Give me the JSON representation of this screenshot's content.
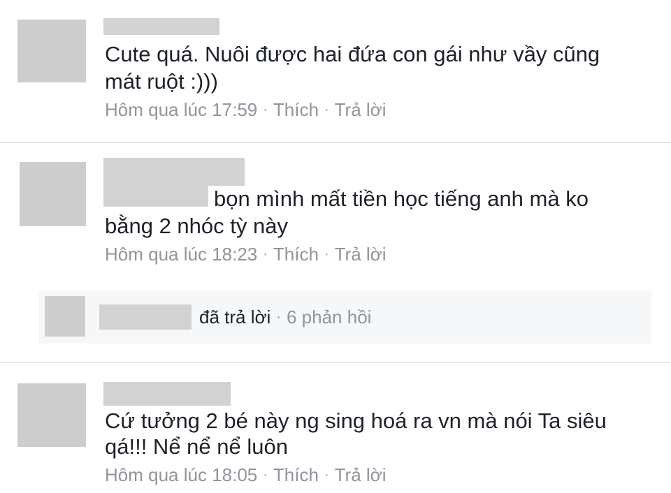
{
  "comments": [
    {
      "text_line1": "Cute quá. Nuôi được hai đứa con gái như vầy cũng",
      "text_line2": "mát ruột :)))",
      "timestamp": "Hôm qua lúc 17:59",
      "like_label": "Thích",
      "reply_label": "Trả lời"
    },
    {
      "text_line1": "bọn mình mất  tiền học tiếng anh mà ko",
      "text_line2": "bằng 2 nhóc tỳ này",
      "timestamp": "Hôm qua lúc 18:23",
      "like_label": "Thích",
      "reply_label": "Trả lời"
    },
    {
      "text_line1": "Cứ tưởng 2 bé này ng sing hoá ra vn mà nói Ta siêu",
      "text_line2": "qá!!! Nể nể nể luôn",
      "timestamp": "Hôm qua lúc 18:05",
      "like_label": "Thích",
      "reply_label": "Trả lời"
    }
  ],
  "reply_summary": {
    "action": "đã trả lời",
    "count": "6 phản hồi"
  },
  "separator": "·"
}
